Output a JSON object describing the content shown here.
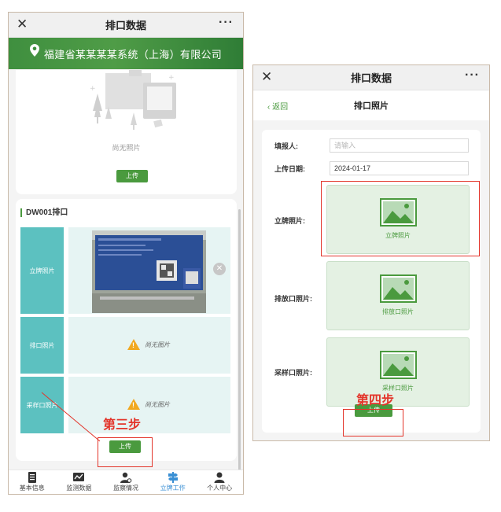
{
  "left_screen": {
    "nav": {
      "close": "✕",
      "title": "排口数据",
      "more": "···"
    },
    "company": {
      "name": "福建省某某某某系统（上海）有限公司"
    },
    "top_card": {
      "empty_text": "尚无照片",
      "upload_label": "上传"
    },
    "outlet_card": {
      "title": "DW001排口",
      "rows": [
        {
          "label": "立牌照片",
          "status": ""
        },
        {
          "label": "排口照片",
          "status": "尚无图片"
        },
        {
          "label": "采样口照片",
          "status": "尚无图片"
        }
      ],
      "remove": "✕",
      "upload_label": "上传"
    },
    "step_label": "第三步",
    "tabs": [
      {
        "label": "基本信息",
        "icon": "document-icon",
        "active": false
      },
      {
        "label": "监测数据",
        "icon": "chart-icon",
        "active": false
      },
      {
        "label": "监察情况",
        "icon": "person-search-icon",
        "active": false
      },
      {
        "label": "立牌工作",
        "icon": "signpost-icon",
        "active": true
      },
      {
        "label": "个人中心",
        "icon": "user-icon",
        "active": false
      }
    ]
  },
  "right_screen": {
    "nav": {
      "close": "✕",
      "title": "排口数据",
      "more": "···"
    },
    "sub_header": {
      "back": "‹ 返回",
      "title": "排口照片"
    },
    "form": {
      "reporter_label": "填报人:",
      "reporter_placeholder": "请输入",
      "date_label": "上传日期:",
      "date_value": "2024-01-17",
      "sign_photo_label": "立牌照片:",
      "sign_photo_caption": "立牌照片",
      "outlet_photo_label": "排放口照片:",
      "outlet_photo_caption": "排放口照片",
      "sampling_photo_label": "采样口照片:",
      "sampling_photo_caption": "采样口照片",
      "upload_label": "上传"
    },
    "step_label": "第四步"
  },
  "colors": {
    "accent_green": "#4a9a3e",
    "teal": "#5cc1c0",
    "annotation_red": "#e3352b",
    "tab_active": "#3a8fd4"
  }
}
